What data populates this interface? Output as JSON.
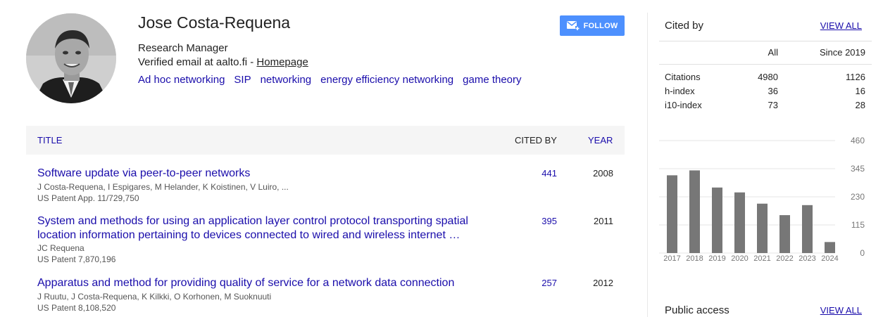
{
  "profile": {
    "name": "Jose Costa-Requena",
    "affiliation": "Research Manager",
    "email_text": "Verified email at aalto.fi - ",
    "homepage_label": "Homepage",
    "interests": [
      "Ad hoc networking",
      "SIP",
      "networking",
      "energy efficiency networking",
      "game theory"
    ],
    "follow_label": "FOLLOW"
  },
  "table": {
    "headers": {
      "title": "TITLE",
      "cited_by": "CITED BY",
      "year": "YEAR"
    },
    "articles": [
      {
        "title_lines": [
          "Software update via peer-to-peer networks"
        ],
        "authors": "J Costa-Requena, I Espigares, M Helander, K Koistinen, V Luiro, ...",
        "venue": "US Patent App. 11/729,750",
        "cited_by": "441",
        "year": "2008"
      },
      {
        "title_lines": [
          "System and methods for using an application layer control protocol transporting spatial",
          "location information pertaining to devices connected to wired and wireless internet …"
        ],
        "authors": "JC Requena",
        "venue": "US Patent 7,870,196",
        "cited_by": "395",
        "year": "2011"
      },
      {
        "title_lines": [
          "Apparatus and method for providing quality of service for a network data connection"
        ],
        "authors": "J Ruutu, J Costa-Requena, K Kilkki, O Korhonen, M Suoknuuti",
        "venue": "US Patent 8,108,520",
        "cited_by": "257",
        "year": "2012"
      }
    ]
  },
  "cited_by": {
    "heading": "Cited by",
    "view_all": "VIEW ALL",
    "col_all": "All",
    "col_since": "Since 2019",
    "rows": [
      {
        "label": "Citations",
        "all": "4980",
        "since": "1126"
      },
      {
        "label": "h-index",
        "all": "36",
        "since": "16"
      },
      {
        "label": "i10-index",
        "all": "73",
        "since": "28"
      }
    ]
  },
  "public_access": {
    "heading": "Public access",
    "view_all": "VIEW ALL"
  },
  "colors": {
    "link": "#1a0dab",
    "follow_bg": "#4d90fe",
    "bar": "#777777"
  },
  "chart_data": {
    "type": "bar",
    "categories": [
      "2017",
      "2018",
      "2019",
      "2020",
      "2021",
      "2022",
      "2023",
      "2024"
    ],
    "values": [
      318,
      338,
      268,
      248,
      202,
      155,
      196,
      45
    ],
    "ylim": [
      0,
      460
    ],
    "yticks": [
      "460",
      "345",
      "230",
      "115",
      "0"
    ],
    "grid": true
  }
}
